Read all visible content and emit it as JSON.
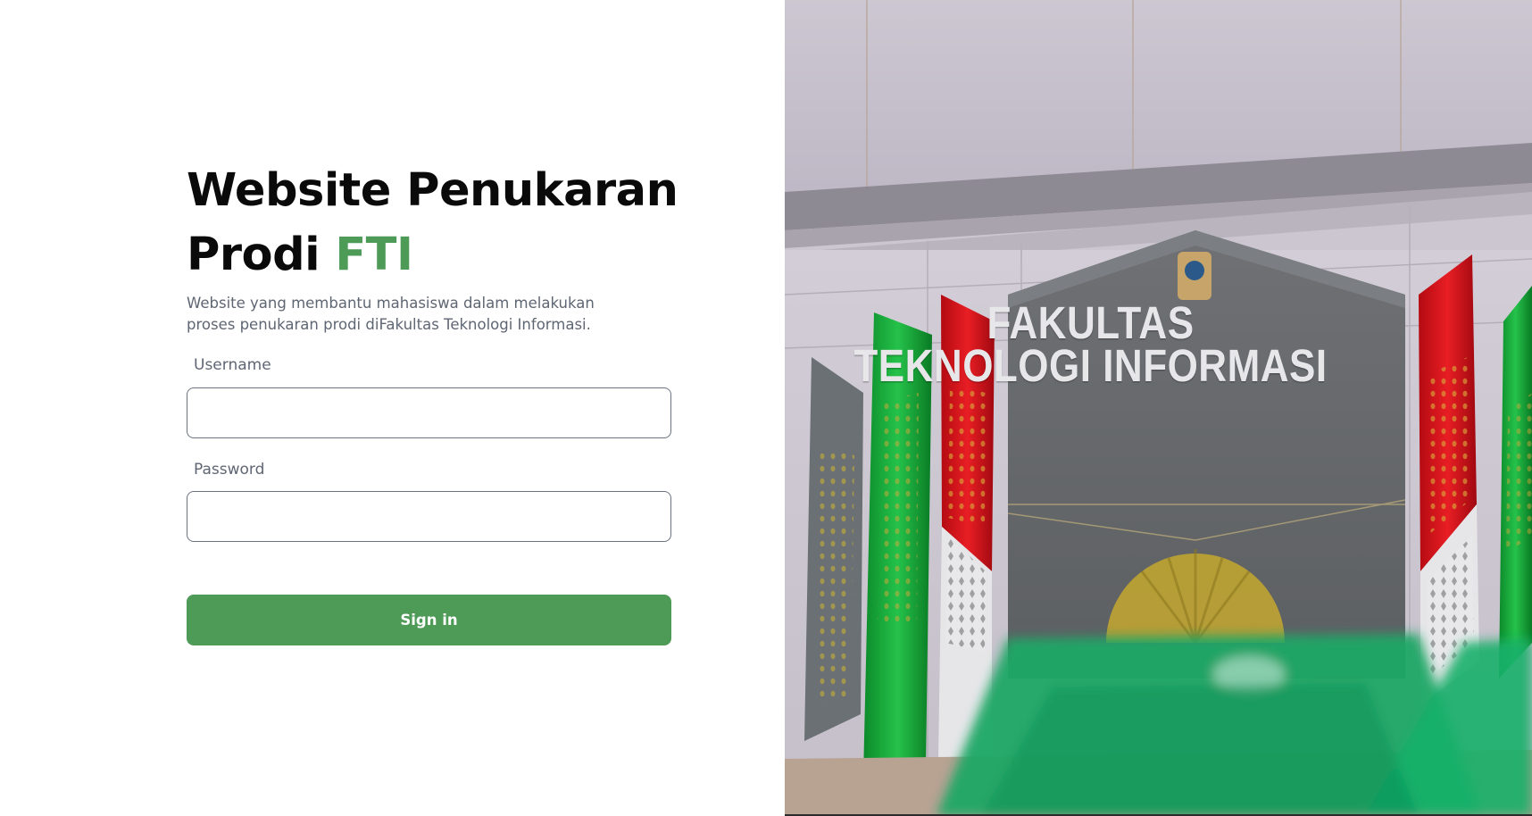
{
  "login": {
    "title_main": "Website Penukaran",
    "title_line2_prefix": "Prodi",
    "title_accent": "FTI",
    "description": "Website yang membantu mahasiswa dalam melakukan proses penukaran prodi diFakultas Teknologi Informasi.",
    "username_label": "Username",
    "username_value": "",
    "password_label": "Password",
    "password_value": "",
    "signin_label": "Sign in"
  },
  "photo": {
    "sign_line1": "FAKULTAS",
    "sign_line2": "TEKNOLOGI INFORMASI"
  },
  "colors": {
    "accent": "#4e9a57",
    "heading": "#0a0a0a",
    "muted_text": "#5f6673"
  }
}
